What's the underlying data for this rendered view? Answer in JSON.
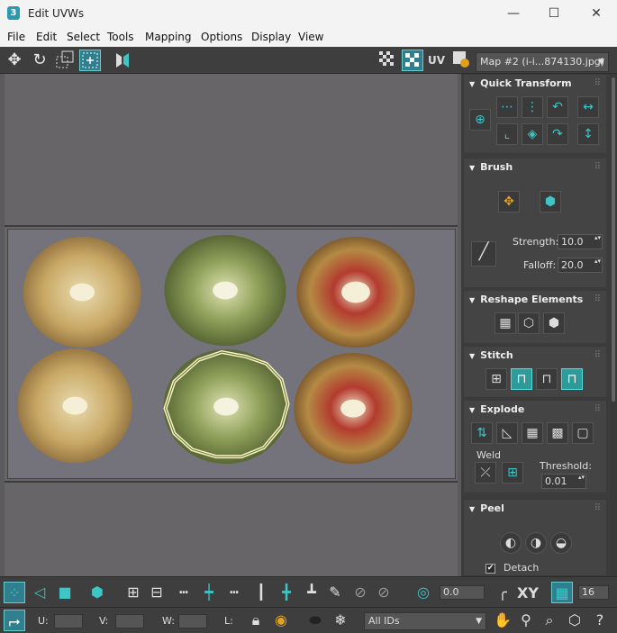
{
  "window": {
    "title": "Edit UVWs",
    "app_icon": "3",
    "minimize": "—",
    "maximize": "☐",
    "close": "✕"
  },
  "menu": [
    "File",
    "Edit",
    "Select",
    "Tools",
    "Mapping",
    "Options",
    "Display",
    "View"
  ],
  "toolbar": {
    "uv_label": "UV",
    "map_select": "Map #2 (i-i...874130.jpg)"
  },
  "panels": {
    "quick_transform": "Quick Transform",
    "brush": "Brush",
    "strength_label": "Strength:",
    "strength_value": "10.0",
    "falloff_label": "Falloff:",
    "falloff_value": "20.0",
    "reshape": "Reshape Elements",
    "stitch": "Stitch",
    "explode": "Explode",
    "weld": "Weld",
    "threshold_label": "Threshold:",
    "threshold_value": "0.01",
    "peel": "Peel",
    "detach": "Detach"
  },
  "bottom": {
    "angle_value": "0.0",
    "xy_label": "XY",
    "grid_value": "16",
    "u_label": "U:",
    "v_label": "V:",
    "w_label": "W:",
    "l_label": "L:",
    "ids_select": "All IDs"
  },
  "colors": {
    "accent": "#3ec6c6",
    "selection": "#f4f4c0"
  }
}
